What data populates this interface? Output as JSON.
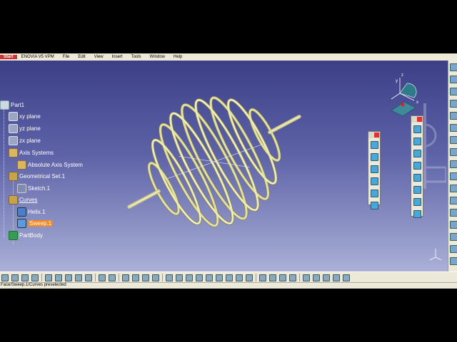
{
  "menu": {
    "start": "Start",
    "items": [
      "ENOVIA V5 VPM",
      "File",
      "Edit",
      "View",
      "Insert",
      "Tools",
      "Window",
      "Help"
    ]
  },
  "tree": {
    "root": "Part1",
    "xy_plane": "xy plane",
    "yz_plane": "yz plane",
    "zx_plane": "zx plane",
    "axis_systems": "Axis Systems",
    "absolute_axis": "Absolute Axis System",
    "geo_set": "Geometrical Set.1",
    "sketch": "Sketch.1",
    "curves": "Curves",
    "helix": "Helix.1",
    "sweep": "Sweep.1",
    "partbody": "PartBody"
  },
  "compass": {
    "x": "x",
    "y": "y",
    "z": "z"
  },
  "status": "Face/Sweep.1/Curves preselected",
  "colors": {
    "viewport_top": "#3c3f86",
    "viewport_bottom": "#aab0d6",
    "selection": "#f08a24",
    "spring": "#e3e0a0"
  }
}
